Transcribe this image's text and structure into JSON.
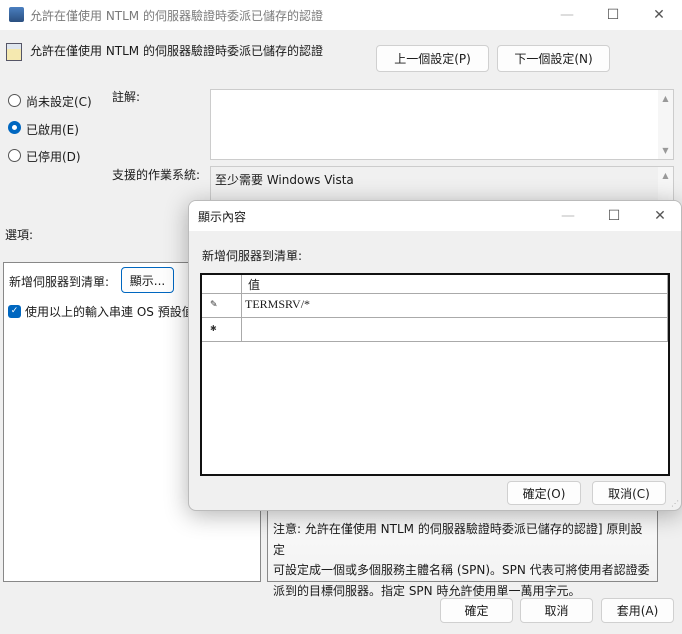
{
  "window": {
    "title": "允許在僅使用 NTLM 的伺服器驗證時委派已儲存的認證",
    "minimize": "—",
    "maximize": "☐",
    "close": "✕"
  },
  "header": {
    "policy_name": "允許在僅使用 NTLM 的伺服器驗證時委派已儲存的認證",
    "prev_button": "上一個設定(P)",
    "next_button": "下一個設定(N)"
  },
  "state": {
    "options": [
      {
        "label": "尚未設定(C)",
        "selected": false
      },
      {
        "label": "已啟用(E)",
        "selected": true
      },
      {
        "label": "已停用(D)",
        "selected": false
      }
    ]
  },
  "comment": {
    "label": "註解:",
    "value": ""
  },
  "supported": {
    "label": "支援的作業系統:",
    "value": "至少需要 Windows Vista"
  },
  "options_label": "選項:",
  "options_panel": {
    "list_label": "新增伺服器到清單:",
    "show_button": "顯示...",
    "checkbox_label": "使用以上的輸入串連 OS 預設值",
    "checkbox_checked": true
  },
  "help_text": [
    "注意: 允許在僅使用 NTLM 的伺服器驗證時委派已儲存的認證] 原則設定",
    "可設定成一個或多個服務主體名稱 (SPN)。SPN 代表可將使用者認證委",
    "派到的目標伺服器。指定 SPN 時允許使用單一萬用字元。"
  ],
  "footer": {
    "ok": "確定",
    "cancel": "取消",
    "apply": "套用(A)"
  },
  "dialog": {
    "title": "顯示內容",
    "label": "新增伺服器到清單:",
    "column_header": "值",
    "rows": [
      {
        "marker": "pencil-icon",
        "value": "TERMSRV/*"
      },
      {
        "marker": "new-row-icon",
        "value": ""
      }
    ],
    "ok": "確定(O)",
    "cancel": "取消(C)"
  },
  "colors": {
    "accent": "#0067c0"
  }
}
